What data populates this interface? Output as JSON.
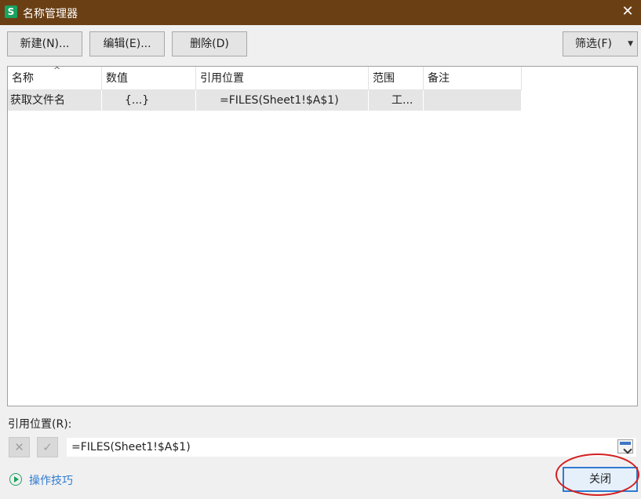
{
  "window": {
    "title": "名称管理器",
    "app_icon": "S",
    "close_glyph": "✕"
  },
  "toolbar": {
    "new_label": "新建(N)...",
    "edit_label": "编辑(E)...",
    "delete_label": "删除(D)",
    "filter_label": "筛选(F)",
    "filter_caret": "▼"
  },
  "table": {
    "sort_caret": "^",
    "headers": [
      "名称",
      "数值",
      "引用位置",
      "范围",
      "备注"
    ],
    "rows": [
      {
        "name": "获取文件名",
        "value": "{...}",
        "ref": "=FILES(Sheet1!$A$1)",
        "scope": "工...",
        "note": ""
      }
    ]
  },
  "refers": {
    "label": "引用位置(R):",
    "cancel_glyph": "✕",
    "confirm_glyph": "✓",
    "value": "=FILES(Sheet1!$A$1)"
  },
  "footer": {
    "tips_label": "操作技巧",
    "close_label": "关闭"
  },
  "colors": {
    "titlebar": "#6b3f14",
    "accent": "#2f7bd0",
    "brand_green": "#1aa260",
    "annotation": "#d42020"
  }
}
